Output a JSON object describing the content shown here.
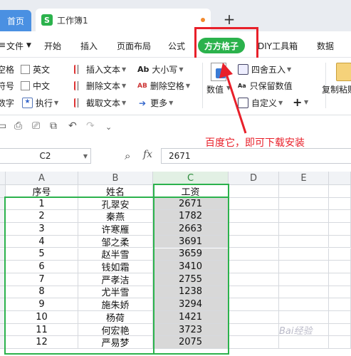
{
  "tabs": {
    "home": "首页",
    "workbook": "工作簿1",
    "new_tab": "+"
  },
  "menu": {
    "file": "文件",
    "start": "开始",
    "insert": "插入",
    "page_layout": "页面布局",
    "formula": "公式",
    "fangfang": "方方格子",
    "diy": "DIY工具箱",
    "data": "数据"
  },
  "ribbon": {
    "left_col1": [
      "空格",
      "符号",
      "数字"
    ],
    "left_col2": [
      "英文",
      "中文",
      "执行"
    ],
    "mid_col1": [
      "插入文本",
      "删除文本",
      "截取文本"
    ],
    "mid_col2": [
      "大小写",
      "删除空格",
      "更多"
    ],
    "numvalue": "数值",
    "right_col": [
      "四舍五入",
      "只保留数值",
      "自定义"
    ],
    "copy_paste": "复制粘贴"
  },
  "formula_bar": {
    "name_box": "C2",
    "fx": "fx",
    "value": "2671"
  },
  "annotation": "百度它，即可下载安装",
  "columns": [
    "A",
    "B",
    "C",
    "D",
    "E"
  ],
  "table": {
    "headers": [
      "序号",
      "姓名",
      "工资"
    ],
    "rows": [
      [
        "1",
        "孔翠安",
        "2671"
      ],
      [
        "2",
        "秦燕",
        "1782"
      ],
      [
        "3",
        "许寒雁",
        "2663"
      ],
      [
        "4",
        "邹之柔",
        "3691"
      ],
      [
        "5",
        "赵半雪",
        "3659"
      ],
      [
        "6",
        "钱如霜",
        "3410"
      ],
      [
        "7",
        "严孝洁",
        "2755"
      ],
      [
        "8",
        "尤半雪",
        "1238"
      ],
      [
        "9",
        "施朱娇",
        "3294"
      ],
      [
        "10",
        "杨荷",
        "1421"
      ],
      [
        "11",
        "何宏艳",
        "3723"
      ],
      [
        "12",
        "严易梦",
        "2075"
      ]
    ]
  },
  "watermark": "Bai经验",
  "colors": {
    "accent_green": "#2bb24c",
    "annotation_red": "#e8202a",
    "tab_blue": "#4a90e2"
  }
}
